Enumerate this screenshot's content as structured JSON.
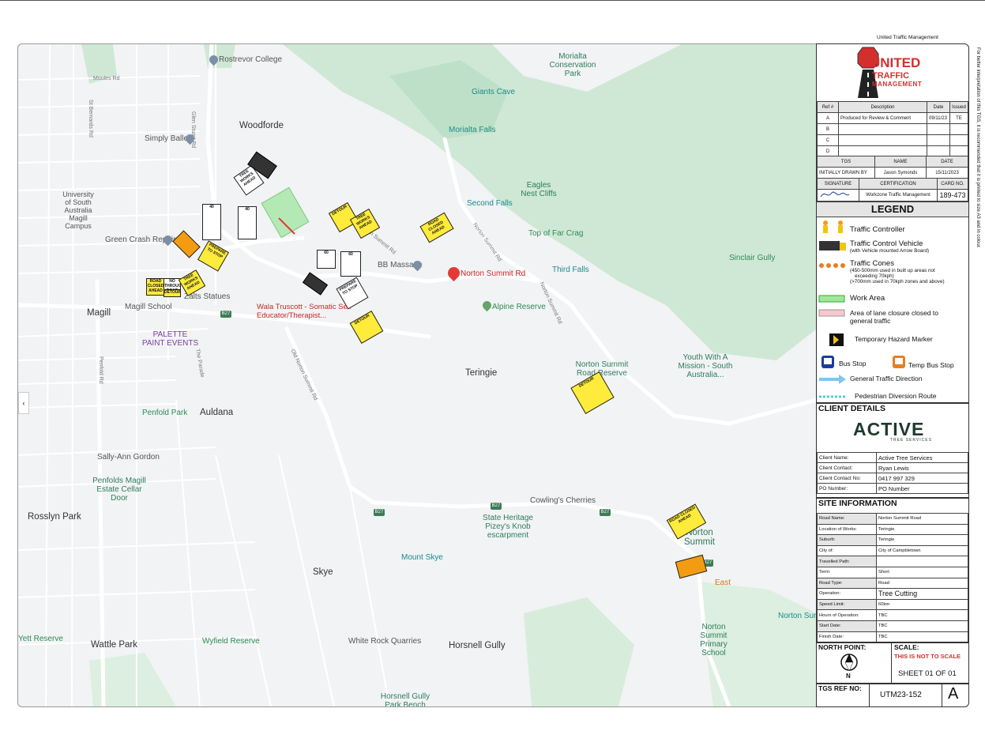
{
  "header": {
    "company": "United Traffic Management",
    "side_note": "For better interpretation of this TGS, it is recommended that it is printed to size A3 and in colour."
  },
  "map": {
    "labels": {
      "rostrevor_college": "Rostrevor College",
      "woodforde": "Woodforde",
      "simply_ballet": "Simply Ballet",
      "unisa": "University of South Australia Magill Campus",
      "green_crash": "Green Crash Repairs",
      "magill": "Magill",
      "magill_school": "Magill School",
      "palette": "PALETTE PAINT EVENTS",
      "zalts": "Zalts Statues",
      "wala": "Wala Truscott - Somatic Sex Educator/Therapist...",
      "bb_massage": "BB Massage",
      "norton_summit_rd_pin": "Norton Summit Rd",
      "alpine_reserve": "Alpine Reserve",
      "teringie": "Teringie",
      "auldana": "Auldana",
      "penfold_park": "Penfold Park",
      "sally_ann": "Sally-Ann Gordon",
      "penfolds": "Penfolds Magill Estate Cellar Door",
      "rosslyn_park": "Rosslyn Park",
      "skye": "Skye",
      "mount_skye": "Mount Skye",
      "cowlings": "Cowling's Cherries",
      "state_heritage": "State Heritage Pizey's Knob escarpment",
      "wattle_park": "Wattle Park",
      "wyfield": "Wyfield Reserve",
      "white_rock": "White Rock Quarries",
      "horsnell_gully": "Horsnell Gully",
      "horsnell_park": "Horsnell Gully Park Bench",
      "giants_cave": "Giants Cave",
      "morialta_falls": "Morialta Falls",
      "morialta_park": "Morialta Conservation Park",
      "eagles_nest": "Eagles Nest Cliffs",
      "second_falls": "Second Falls",
      "top_far_crag": "Top of Far Crag",
      "third_falls": "Third Falls",
      "sinclair_gully": "Sinclair Gully",
      "norton_reserve": "Norton Summit Road Reserve",
      "youth_mission": "Youth With A Mission - South Australia...",
      "norton_summit": "Norton Summit",
      "norton_primary": "Norton Summit Primary School",
      "norton_sum_short": "Norton Summ",
      "east": "East",
      "yett_reserve": "Yett Reserve",
      "magill_rd": "Magill Rd",
      "moules_rd": "Moules Rd",
      "glen_stuart_rd": "Glen Stuart Rd",
      "norton_summit_rd": "Norton Summit Rd",
      "old_norton_rd": "Old Norton Summit Rd",
      "penfold_rd": "Penfold Rd",
      "st_bernards_rd": "St Bernards Rd",
      "the_parade": "The Parade",
      "route_b27": "B27"
    },
    "signs": {
      "road_closed_ahead": "ROAD CLOSED AHEAD",
      "no_through_road": "NO THROUGH ROAD",
      "detour": "DETOUR",
      "speed_40": "40",
      "speed_60": "60",
      "tree_works": "TREE WORKS AHEAD",
      "prepare_to_stop": "PREPARE TO STOP"
    }
  },
  "title_block": {
    "logo_line1": "UNITED",
    "logo_line2": "TRAFFIC",
    "logo_line3": "MANAGEMENT",
    "rev_headers": [
      "Ref #",
      "Description",
      "Date",
      "Issued"
    ],
    "revisions": [
      [
        "A",
        "Produced for Review & Comment",
        "09/11/23",
        "TE"
      ],
      [
        "B",
        "",
        "",
        ""
      ],
      [
        "C",
        "",
        "",
        ""
      ],
      [
        "D",
        "",
        "",
        ""
      ]
    ],
    "tgs_headers": [
      "TGS",
      "NAME",
      "DATE"
    ],
    "tgs_row": [
      "INITIALLY DRAWN BY",
      "Jason Symonds",
      "15/11/2023"
    ],
    "sig_headers": [
      "SIGNATURE",
      "CERTIFICATION",
      "CARD NO."
    ],
    "sig_row": [
      "Workzone Traffic Management",
      "189-473"
    ],
    "legend": {
      "title": "LEGEND",
      "traffic_controller": "Traffic Controller",
      "tcv": "Traffic Control Vehicle",
      "tcv_sub": "(with Vehicle mounted Arrow Board)",
      "cones": "Traffic Cones",
      "cones_sub1": "(450-500mm used in built up areas not",
      "cones_sub2": "exceeding 70kph)",
      "cones_sub3": "(>700mm used in 70kph zones and above)",
      "work_area": "Work Area",
      "lane_closure": "Area of lane closure closed to general traffic",
      "hazard_marker": "Temporary Hazard Marker",
      "bus_stop": "Bus Stop",
      "temp_bus_stop": "Temp Bus Stop",
      "traffic_direction": "General Traffic Direction",
      "ped_route": "Pedestrian Diversion Route"
    },
    "client": {
      "title": "CLIENT DETAILS",
      "logo": "ACTIVE",
      "logo_sub": "TREE SERVICES",
      "rows": [
        [
          "Client Name:",
          "Active Tree Services"
        ],
        [
          "Client Contact:",
          "Ryan Lewis"
        ],
        [
          "Client Contact No:",
          "0417 997 329"
        ],
        [
          "PO Number:",
          "PO Number"
        ]
      ]
    },
    "site": {
      "title": "SITE INFORMATION",
      "rows": [
        [
          "Road Name:",
          "Norton Summit Road"
        ],
        [
          "Location of Works:",
          "Teringie"
        ],
        [
          "Suburb:",
          "Teringie"
        ],
        [
          "City of:",
          "City of Campbletown"
        ],
        [
          "Travelled Path:",
          ""
        ],
        [
          "Term:",
          "Short"
        ],
        [
          "Road Type:",
          "Road"
        ],
        [
          "Operation:",
          "Tree Cutting"
        ],
        [
          "Speed Limit:",
          "60km"
        ],
        [
          "Hours of Operation:",
          "TBC"
        ],
        [
          "Start Date:",
          "TBC"
        ],
        [
          "Finish Date:",
          "TBC"
        ]
      ]
    },
    "north_point": "NORTH POINT:",
    "north_letter": "N",
    "scale_label": "SCALE:",
    "scale_note": "THIS IS NOT TO SCALE",
    "sheet": "SHEET 01 OF 01",
    "tgs_ref_label": "TGS REF NO:",
    "tgs_ref": "UTM23-152",
    "rev_letter": "A"
  }
}
